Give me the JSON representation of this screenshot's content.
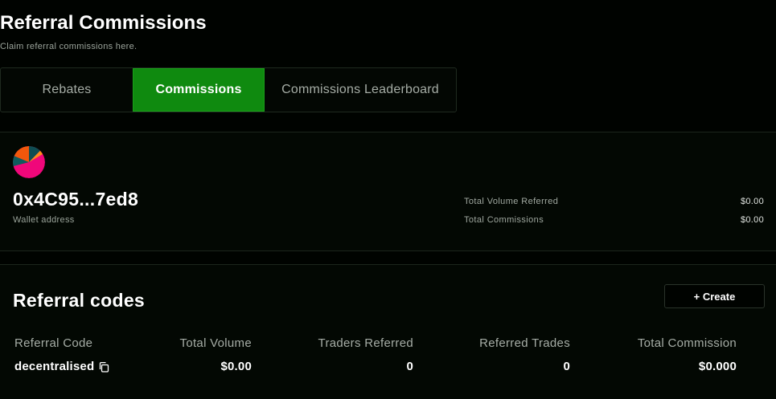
{
  "header": {
    "title": "Referral Commissions",
    "subtitle": "Claim referral commissions here."
  },
  "tabs": [
    {
      "label": "Rebates",
      "active": false
    },
    {
      "label": "Commissions",
      "active": true
    },
    {
      "label": "Commissions Leaderboard",
      "active": false
    }
  ],
  "wallet": {
    "address": "0x4C95...7ed8",
    "address_label": "Wallet address",
    "avatar_icon": "pie-avatar-icon",
    "stats": [
      {
        "label": "Total Volume Referred",
        "value": "$0.00"
      },
      {
        "label": "Total Commissions",
        "value": "$0.00"
      }
    ]
  },
  "referral_codes": {
    "title": "Referral codes",
    "create_label": "+ Create",
    "columns": [
      "Referral Code",
      "Total Volume",
      "Traders Referred",
      "Referred Trades",
      "Total Commission"
    ],
    "rows": [
      {
        "code": "decentralised",
        "total_volume": "$0.00",
        "traders_referred": "0",
        "referred_trades": "0",
        "total_commission": "$0.000"
      }
    ]
  },
  "colors": {
    "accent": "#0f8a0f",
    "background": "#000300"
  }
}
